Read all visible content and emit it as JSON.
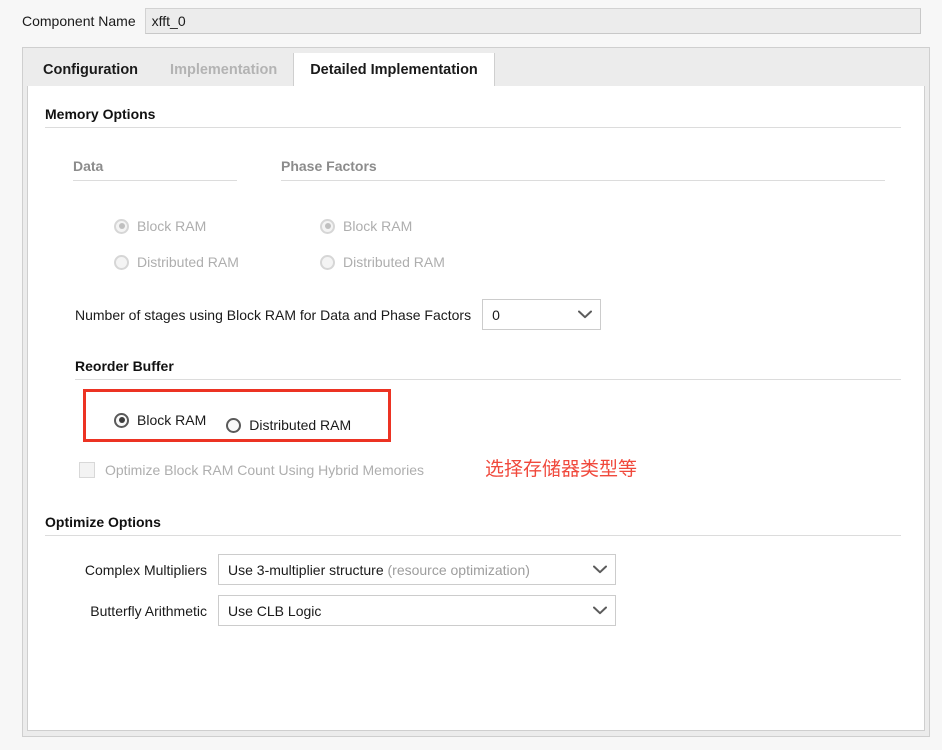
{
  "header": {
    "component_name_label": "Component Name",
    "component_name_value": "xfft_0"
  },
  "tabs": [
    {
      "label": "Configuration",
      "state": "enabled"
    },
    {
      "label": "Implementation",
      "state": "disabled"
    },
    {
      "label": "Detailed Implementation",
      "state": "active"
    }
  ],
  "memory_options": {
    "title": "Memory Options",
    "data_group": {
      "title": "Data",
      "options": [
        {
          "label": "Block RAM",
          "checked": true,
          "disabled": true
        },
        {
          "label": "Distributed RAM",
          "checked": false,
          "disabled": true
        }
      ]
    },
    "phase_factors_group": {
      "title": "Phase Factors",
      "options": [
        {
          "label": "Block RAM",
          "checked": true,
          "disabled": true
        },
        {
          "label": "Distributed RAM",
          "checked": false,
          "disabled": true
        }
      ]
    },
    "stages": {
      "label": "Number of stages using Block RAM for Data and Phase Factors",
      "value": "0",
      "chevron_icon": "chevron-down-icon"
    }
  },
  "reorder_buffer": {
    "title": "Reorder Buffer",
    "options": [
      {
        "label": "Block RAM",
        "checked": true,
        "disabled": false
      },
      {
        "label": "Distributed RAM",
        "checked": false,
        "disabled": false
      }
    ],
    "hybrid_checkbox": {
      "label": "Optimize Block RAM Count Using Hybrid Memories",
      "checked": false,
      "disabled": true
    }
  },
  "annotation": {
    "text": "选择存储器类型等",
    "color": "#f0493c",
    "highlight_color": "#ec3323"
  },
  "optimize_options": {
    "title": "Optimize Options",
    "complex_multipliers": {
      "label": "Complex Multipliers",
      "value_main": "Use 3-multiplier structure",
      "value_muted": "(resource optimization)",
      "chevron_icon": "chevron-down-icon"
    },
    "butterfly_arithmetic": {
      "label": "Butterfly Arithmetic",
      "value_main": "Use CLB Logic",
      "value_muted": "",
      "chevron_icon": "chevron-down-icon"
    }
  }
}
